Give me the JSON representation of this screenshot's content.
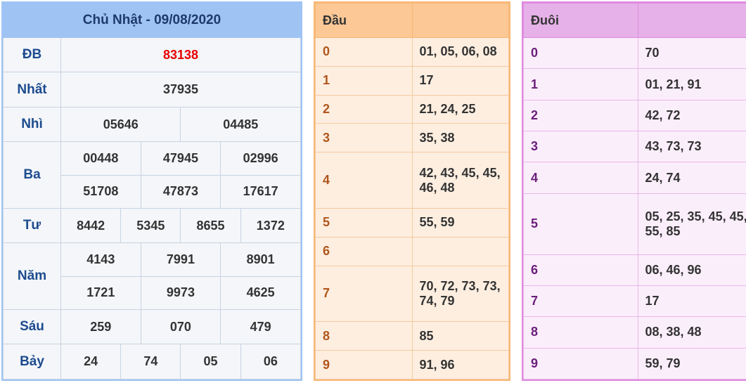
{
  "main": {
    "title": "Chủ Nhật - 09/08/2020",
    "special_color": "#e60000",
    "prizes": {
      "db": {
        "label": "ĐB",
        "values": [
          "83138"
        ]
      },
      "nhat": {
        "label": "Nhất",
        "values": [
          "37935"
        ]
      },
      "nhi": {
        "label": "Nhì",
        "values": [
          "05646",
          "04485"
        ]
      },
      "ba": {
        "label": "Ba",
        "values": [
          "00448",
          "47945",
          "02996",
          "51708",
          "47873",
          "17617"
        ]
      },
      "tu": {
        "label": "Tư",
        "values": [
          "8442",
          "5345",
          "8655",
          "1372"
        ]
      },
      "nam": {
        "label": "Năm",
        "values": [
          "4143",
          "7991",
          "8901",
          "1721",
          "9973",
          "4625"
        ]
      },
      "sau": {
        "label": "Sáu",
        "values": [
          "259",
          "070",
          "479"
        ]
      },
      "bay": {
        "label": "Bảy",
        "values": [
          "24",
          "74",
          "05",
          "06"
        ]
      }
    }
  },
  "dau": {
    "header": "Đầu",
    "rows": [
      {
        "digit": "0",
        "values": "01, 05, 06, 08"
      },
      {
        "digit": "1",
        "values": "17"
      },
      {
        "digit": "2",
        "values": "21, 24, 25"
      },
      {
        "digit": "3",
        "values": "35, 38"
      },
      {
        "digit": "4",
        "values": "42, 43, 45, 45, 46, 48"
      },
      {
        "digit": "5",
        "values": "55, 59"
      },
      {
        "digit": "6",
        "values": ""
      },
      {
        "digit": "7",
        "values": "70, 72, 73, 73, 74, 79"
      },
      {
        "digit": "8",
        "values": "85"
      },
      {
        "digit": "9",
        "values": "91, 96"
      }
    ]
  },
  "duoi": {
    "header": "Đuôi",
    "rows": [
      {
        "digit": "0",
        "values": "70"
      },
      {
        "digit": "1",
        "values": "01, 21, 91"
      },
      {
        "digit": "2",
        "values": "42, 72"
      },
      {
        "digit": "3",
        "values": "43, 73, 73"
      },
      {
        "digit": "4",
        "values": "24, 74"
      },
      {
        "digit": "5",
        "values": "05, 25, 35, 45, 45, 55, 85"
      },
      {
        "digit": "6",
        "values": "06, 46, 96"
      },
      {
        "digit": "7",
        "values": "17"
      },
      {
        "digit": "8",
        "values": "08, 38, 48"
      },
      {
        "digit": "9",
        "values": "59, 79"
      }
    ]
  }
}
